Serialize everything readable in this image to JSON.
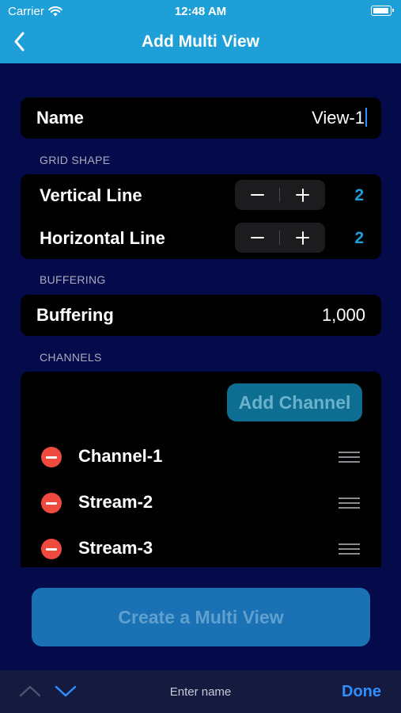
{
  "status_bar": {
    "carrier": "Carrier",
    "time": "12:48 AM",
    "icons": [
      "wifi-icon",
      "battery-icon"
    ]
  },
  "nav": {
    "title": "Add Multi View",
    "back_icon": "chevron-left-icon"
  },
  "name_row": {
    "label": "Name",
    "value": "View-1"
  },
  "grid_shape": {
    "header": "GRID SHAPE",
    "vertical": {
      "label": "Vertical Line",
      "value": "2"
    },
    "horizontal": {
      "label": "Horizontal Line",
      "value": "2"
    }
  },
  "buffering": {
    "header": "BUFFERING",
    "label": "Buffering",
    "value": "1,000"
  },
  "channels": {
    "header": "CHANNELS",
    "add_button": "Add Channel",
    "items": [
      {
        "name": "Channel-1"
      },
      {
        "name": "Stream-2"
      },
      {
        "name": "Stream-3"
      }
    ]
  },
  "create_button": "Create a Multi View",
  "keyboard_toolbar": {
    "hint": "Enter name",
    "done": "Done"
  },
  "colors": {
    "accent": "#1f9fd8",
    "background": "#050a4a",
    "delete": "#f04a3f",
    "done": "#2f8fff"
  }
}
